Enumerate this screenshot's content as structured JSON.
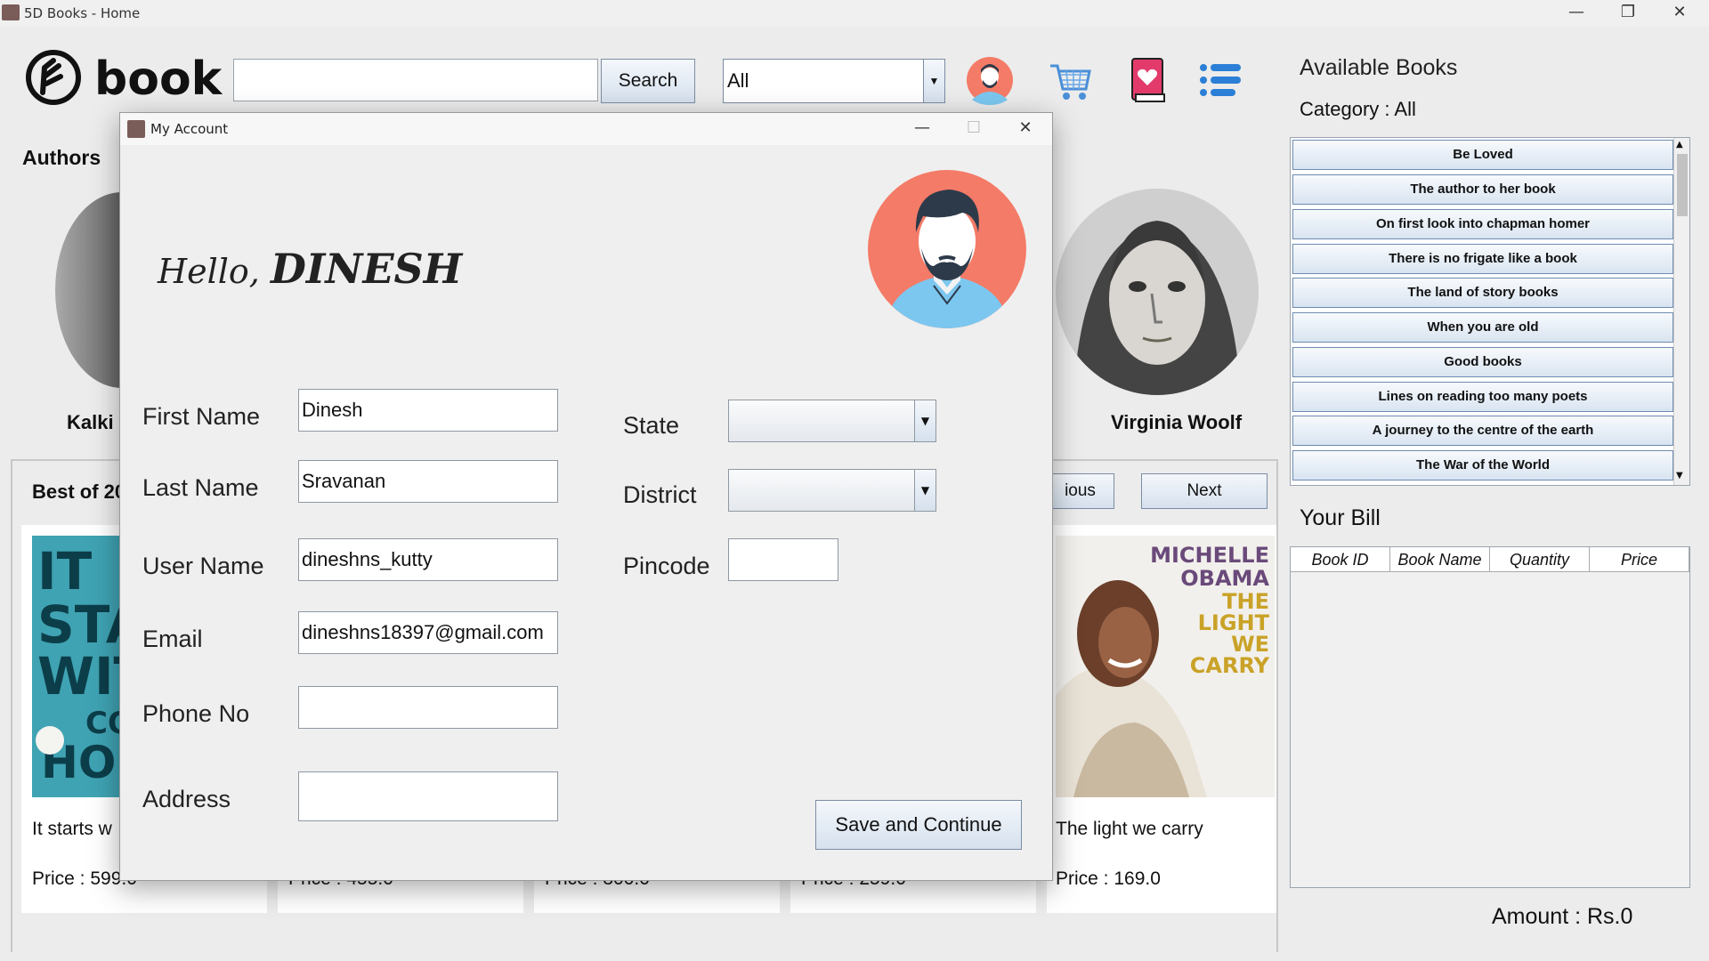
{
  "window": {
    "title": "5D Books - Home",
    "controls": {
      "minimize": "—",
      "restore": "❐",
      "close": "✕"
    }
  },
  "toolbar": {
    "search_value": "",
    "search_label": "Search",
    "category_selected": "All",
    "icons": [
      "user-avatar-icon",
      "cart-icon",
      "favorite-book-icon",
      "menu-list-icon"
    ]
  },
  "home": {
    "authors_label": "Authors",
    "authors": [
      "Kalki",
      "Virginia Woolf"
    ],
    "best_label": "Best of 20",
    "prev_label": "ious",
    "next_label": "Next",
    "books": [
      {
        "title": "It starts w",
        "price": "Price : 599.0"
      },
      {
        "title": "",
        "price": "Price : 455.0"
      },
      {
        "title": "",
        "price": "Price : 300.0"
      },
      {
        "title": "",
        "price": "Price : 259.0"
      },
      {
        "title": "The light we carry",
        "price": "Price : 169.0"
      }
    ],
    "cover_texts": {
      "book1": [
        "IT",
        "STA",
        "WIT",
        "CO",
        "HO"
      ],
      "book5_author": [
        "MICHELLE",
        "OBAMA"
      ],
      "book5_title": [
        "THE",
        "LIGHT",
        "WE",
        "CARRY"
      ]
    }
  },
  "right_panel": {
    "available_title": "Available Books",
    "category_label": "Category  :  All",
    "books": [
      "Be Loved",
      "The author to her book",
      "On first look into chapman homer",
      "There is no frigate like a book",
      "The land of story books",
      "When you are old",
      "Good books",
      "Lines on reading too many poets",
      "A journey to the centre of the earth",
      "The War of the World"
    ],
    "bill_title": "Your Bill",
    "bill_columns": [
      "Book ID",
      "Book Name",
      "Quantity",
      "Price"
    ],
    "amount": "Amount :  Rs.0"
  },
  "dialog": {
    "title": "My Account",
    "greeting": "Hello, ",
    "user_name": "DINESH",
    "labels": {
      "first_name": "First Name",
      "last_name": "Last Name",
      "user_name": "User Name",
      "email": "Email",
      "phone": "Phone No",
      "address": "Address",
      "state": "State",
      "district": "District",
      "pincode": "Pincode"
    },
    "values": {
      "first_name": "Dinesh",
      "last_name": "Sravanan",
      "user_name": "dineshns_kutty",
      "email": "dineshns18397@gmail.com",
      "phone": "",
      "address": "",
      "state": "",
      "district": "",
      "pincode": ""
    },
    "save_label": "Save and Continue"
  },
  "colors": {
    "avatar_bg": "#f47b67",
    "avatar_shirt": "#7cc7f0",
    "button_gradient_top": "#f4f7fb",
    "button_gradient_bottom": "#d6e1ee",
    "list_border": "#6e8bb0"
  }
}
